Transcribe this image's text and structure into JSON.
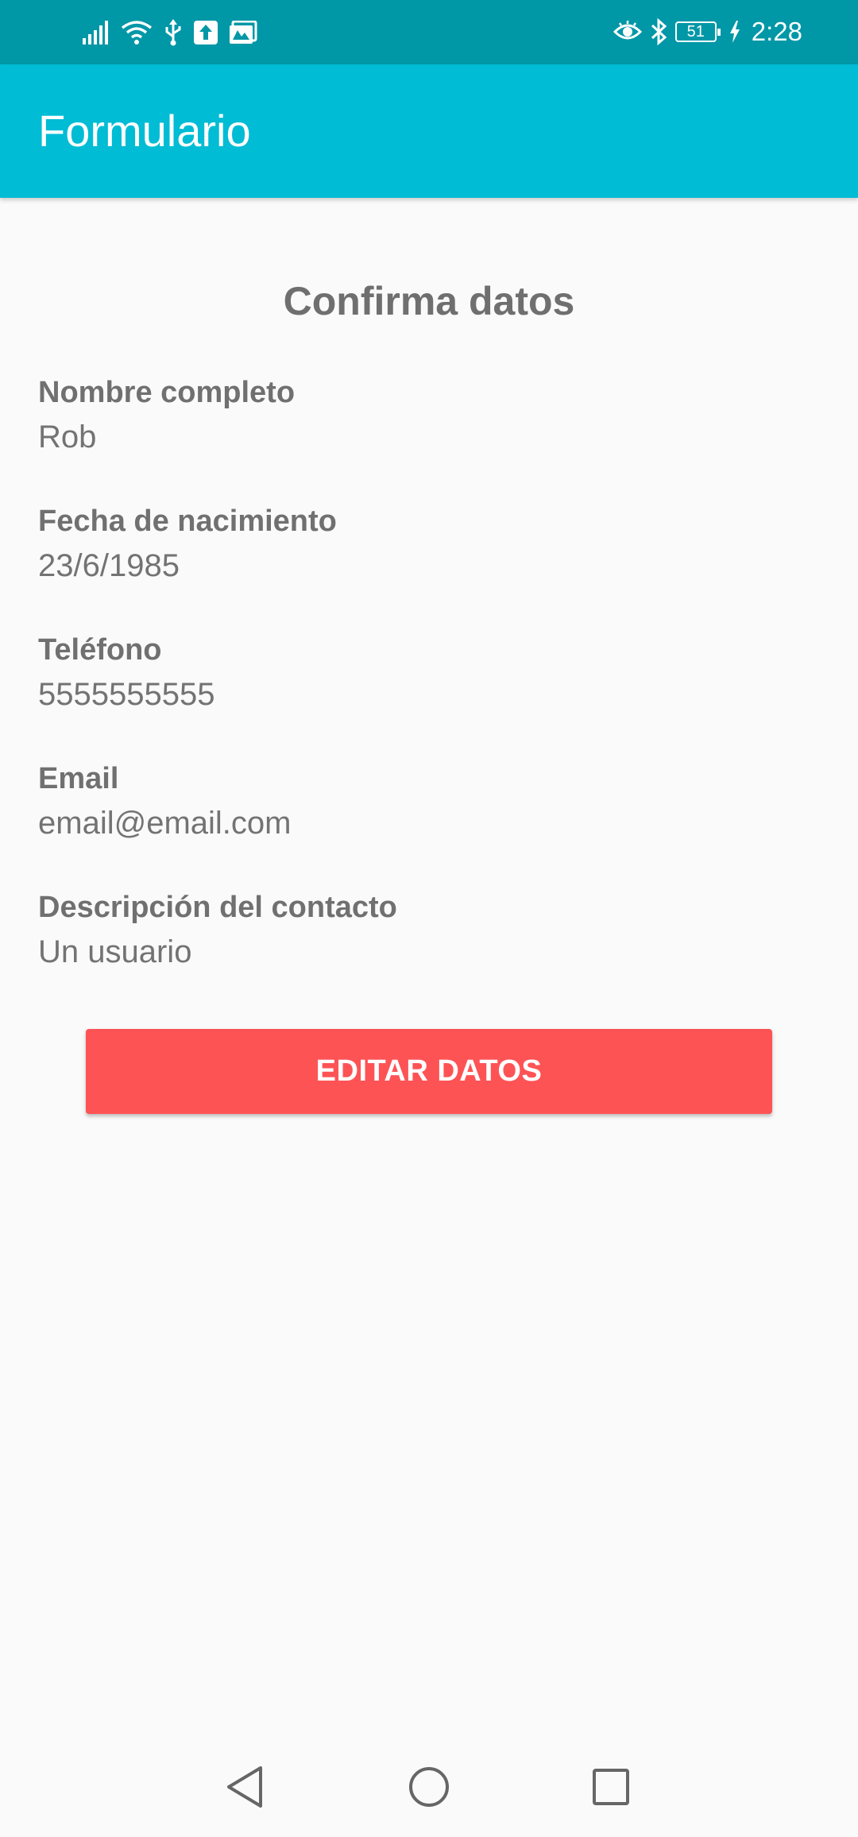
{
  "status_bar": {
    "time": "2:28",
    "battery_level": "51",
    "icons_left": [
      "signal-icon",
      "wifi-icon",
      "usb-icon",
      "upload-icon",
      "gallery-icon"
    ],
    "icons_right": [
      "eye-icon",
      "bluetooth-icon",
      "battery-icon",
      "charging-icon"
    ]
  },
  "app_bar": {
    "title": "Formulario",
    "color": "#00bcd4"
  },
  "main": {
    "heading": "Confirma datos",
    "fields": [
      {
        "label": "Nombre completo",
        "value": "Rob"
      },
      {
        "label": "Fecha de nacimiento",
        "value": "23/6/1985"
      },
      {
        "label": "Teléfono",
        "value": "5555555555"
      },
      {
        "label": "Email",
        "value": "email@email.com"
      },
      {
        "label": "Descripción del contacto",
        "value": "Un usuario"
      }
    ],
    "edit_button_label": "EDITAR DATOS",
    "edit_button_color": "#fe5355"
  },
  "nav_bar": {
    "buttons": [
      "back-icon",
      "home-icon",
      "recents-icon"
    ]
  }
}
